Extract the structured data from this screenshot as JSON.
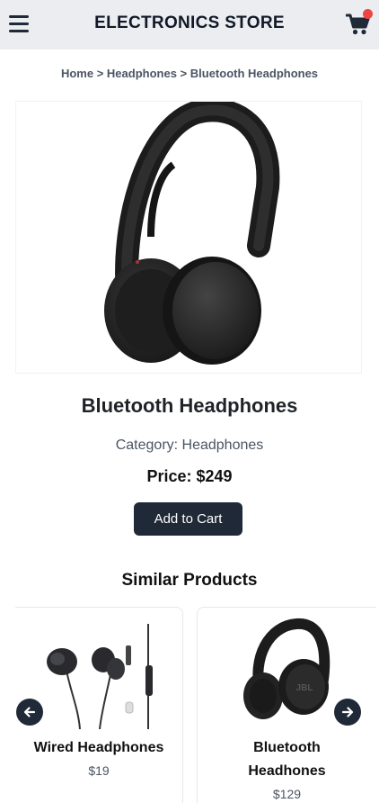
{
  "header": {
    "title": "ELECTRONICS STORE"
  },
  "breadcrumb": {
    "items": [
      "Home",
      "Headphones",
      "Bluetooth Headphones"
    ],
    "separator": ">"
  },
  "product": {
    "name": "Bluetooth Headphones",
    "category_text": "Category: Headphones",
    "price_text": "Price: $249",
    "add_to_cart_label": "Add to Cart"
  },
  "similar": {
    "title": "Similar Products",
    "items": [
      {
        "name": "Wired Headphones",
        "price": "$19"
      },
      {
        "name": "Bluetooth Headhones",
        "price": "$129"
      }
    ]
  },
  "icons": {
    "menu": "menu-icon",
    "cart": "cart-icon",
    "prev": "arrow-left-icon",
    "next": "arrow-right-icon"
  },
  "colors": {
    "header_bg": "#ebedf0",
    "primary_dark": "#1f2937",
    "badge_red": "#ef4444"
  }
}
